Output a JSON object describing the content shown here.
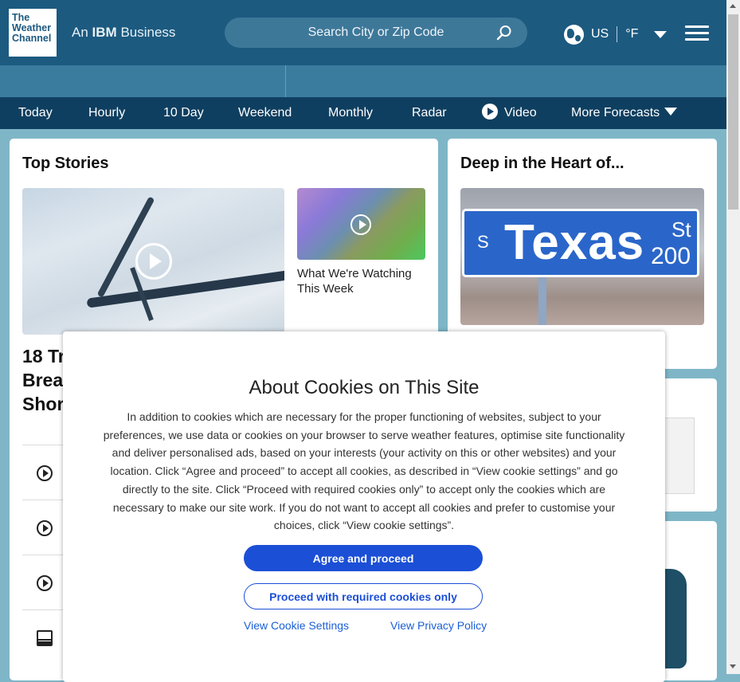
{
  "header": {
    "logo_lines": [
      "The",
      "Weather",
      "Channel"
    ],
    "ibm_prefix": "An",
    "ibm_brand": "IBM",
    "ibm_suffix": "Business",
    "search_placeholder": "Search City or Zip Code",
    "locale": "US",
    "unit": "°F"
  },
  "nav": {
    "items": [
      "Today",
      "Hourly",
      "10 Day",
      "Weekend",
      "Monthly",
      "Radar",
      "Video",
      "More Forecasts"
    ]
  },
  "top_stories": {
    "title": "Top Stories",
    "secondary_caption": "What We're Watching This Week",
    "main_headline_visible": "18 Tr\nBrea\nShor"
  },
  "deep_heart": {
    "title": "Deep in the Heart of...",
    "sign_prefix": "S",
    "sign_main": "Texas",
    "sign_suffix": "St",
    "sign_number": "200"
  },
  "cookie_modal": {
    "title": "About Cookies on This Site",
    "body": "In addition to cookies which are necessary for the proper functioning of websites, subject to your preferences, we use data or cookies on your browser to serve weather features, optimise site functionality and deliver personalised ads, based on your interests (your activity on this or other websites) and your location. Click “Agree and proceed” to accept all cookies, as described in “View cookie settings” and go directly to the site. Click “Proceed with required cookies only” to accept only the cookies which are necessary to make our site work. If you do not want to accept all cookies and prefer to customise your choices, click “View cookie settings”.",
    "agree_label": "Agree and proceed",
    "required_label": "Proceed with required cookies only",
    "settings_link": "View Cookie Settings",
    "privacy_link": "View Privacy Policy"
  },
  "colors": {
    "header_bg": "#1c5a80",
    "nav_bg": "#0f3f60",
    "accent_button": "#1b4fd6"
  }
}
